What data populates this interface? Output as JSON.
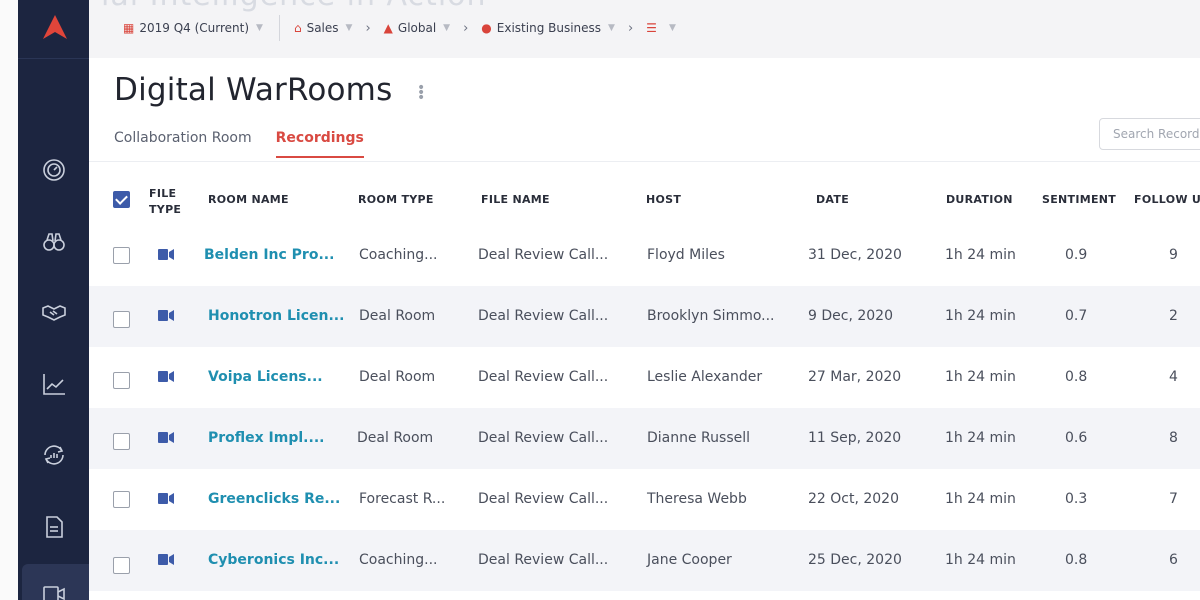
{
  "banner": {
    "text": "ial Intelligence in Action"
  },
  "breadcrumb": [
    {
      "label": "2019 Q4 (Current)",
      "icon": "calendar-icon"
    },
    {
      "label": "Sales",
      "icon": "bank-icon"
    },
    {
      "label": "Global",
      "icon": "hierarchy-icon"
    },
    {
      "label": "Existing Business",
      "icon": "users-icon"
    },
    {
      "label": "",
      "icon": "list-icon"
    }
  ],
  "page": {
    "title": "Digital WarRooms",
    "tabs": [
      {
        "label": "Collaboration Room",
        "active": false
      },
      {
        "label": "Recordings",
        "active": true
      }
    ],
    "search_placeholder": "Search Recordings"
  },
  "sidebar": {
    "icons": [
      "speedometer-icon",
      "binoculars-icon",
      "handshake-icon",
      "line-chart-icon",
      "refresh-chart-icon",
      "document-icon",
      "video-icon"
    ]
  },
  "colors": {
    "accent": "#d94a42",
    "sidebar": "#1c2540",
    "link": "#1f8fb0",
    "checkbox": "#3d5ba9"
  },
  "table": {
    "headers": {
      "file_type": "FILE TYPE",
      "file_type_line1": "FILE",
      "file_type_line2": "TYPE",
      "room_name": "ROOM NAME",
      "room_type": "ROOM TYPE",
      "file_name": "FILE NAME",
      "host": "HOST",
      "date": "DATE",
      "duration": "DURATION",
      "sentiment": "SENTIMENT",
      "follow_up": "FOLLOW UP"
    },
    "header_checked": true,
    "rows": [
      {
        "room_name": "Belden Inc Pro...",
        "room_type": "Coaching...",
        "file_name": "Deal Review Call...",
        "host": "Floyd Miles",
        "date": "31 Dec, 2020",
        "duration": "1h 24 min",
        "sentiment": "0.9",
        "follow_up": "9"
      },
      {
        "room_name": "Honotron Licen...",
        "room_type": "Deal Room",
        "file_name": "Deal Review Call...",
        "host": "Brooklyn Simmo...",
        "date": "9 Dec, 2020",
        "duration": "1h 24 min",
        "sentiment": "0.7",
        "follow_up": "2"
      },
      {
        "room_name": "Voipa Licens...",
        "room_type": "Deal Room",
        "file_name": "Deal Review Call...",
        "host": "Leslie Alexander",
        "date": "27 Mar, 2020",
        "duration": "1h 24 min",
        "sentiment": "0.8",
        "follow_up": "4"
      },
      {
        "room_name": "Proflex Impl....",
        "room_type": "Deal Room",
        "file_name": "Deal Review Call...",
        "host": "Dianne Russell",
        "date": "11 Sep, 2020",
        "duration": "1h 24 min",
        "sentiment": "0.6",
        "follow_up": "8"
      },
      {
        "room_name": "Greenclicks Re...",
        "room_type": "Forecast R...",
        "file_name": "Deal Review Call...",
        "host": "Theresa Webb",
        "date": "22 Oct, 2020",
        "duration": "1h 24 min",
        "sentiment": "0.3",
        "follow_up": "7"
      },
      {
        "room_name": "Cyberonics Inc...",
        "room_type": "Coaching...",
        "file_name": "Deal Review Call...",
        "host": "Jane Cooper",
        "date": "25 Dec, 2020",
        "duration": "1h 24 min",
        "sentiment": "0.8",
        "follow_up": "6"
      }
    ]
  }
}
